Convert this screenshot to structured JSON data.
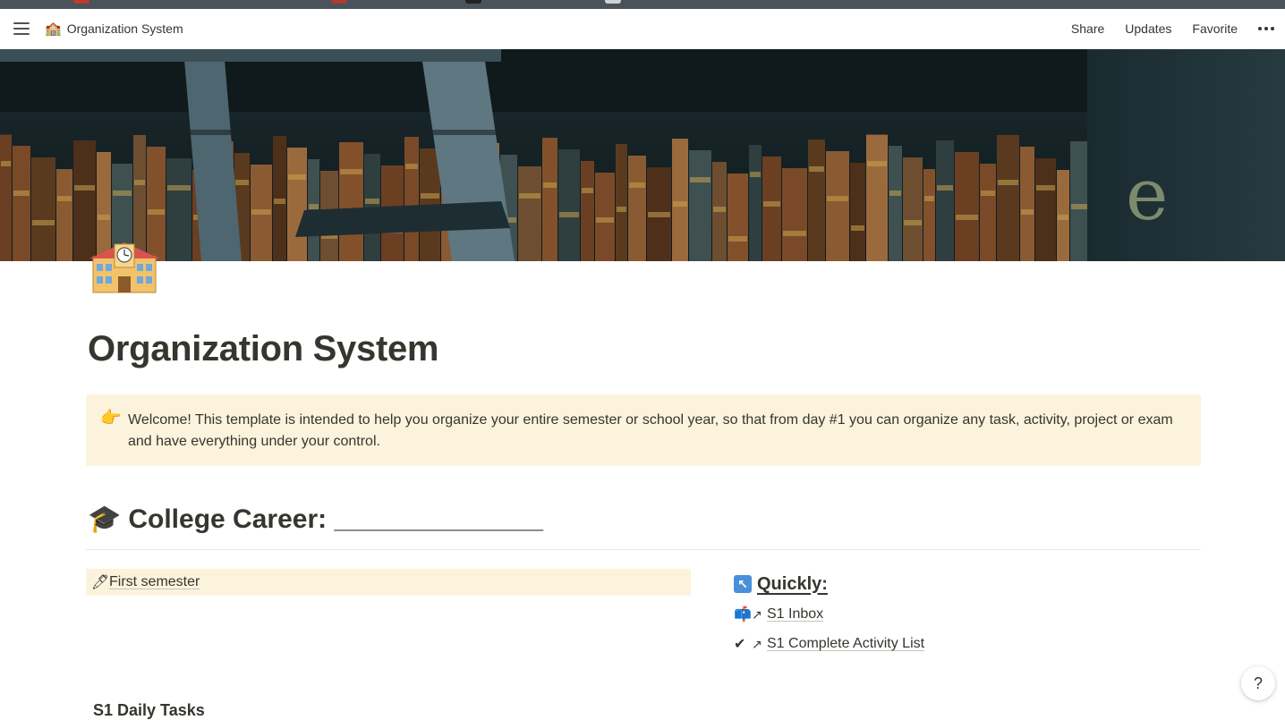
{
  "topbar": {
    "breadcrumb_icon": "🏫",
    "breadcrumb": "Organization System",
    "share": "Share",
    "updates": "Updates",
    "favorite": "Favorite"
  },
  "page": {
    "icon": "school-building-icon",
    "title": "Organization System"
  },
  "callout": {
    "icon": "👉",
    "text": "Welcome! This template is intended to help you organize your entire semester or school year, so that from day #1 you can organize any task, activity, project or exam and have everything under your control."
  },
  "career": {
    "icon": "🎓",
    "heading": "College Career: ______________"
  },
  "semester": {
    "icon": "🖊",
    "label": "First semester"
  },
  "quickly": {
    "icon": "↖",
    "label": "Quickly:",
    "links": [
      {
        "icon": "📫",
        "arrow": "↗",
        "label": "S1 Inbox"
      },
      {
        "icon": "✔",
        "arrow": "↗",
        "label": "S1 Complete Activity List"
      }
    ]
  },
  "cut_off": {
    "label": "S1 Daily Tasks"
  },
  "help": {
    "label": "?"
  },
  "colors": {
    "callout_bg": "#fbf3db",
    "text": "#37352f",
    "quick_icon_bg": "#4a90d9"
  }
}
